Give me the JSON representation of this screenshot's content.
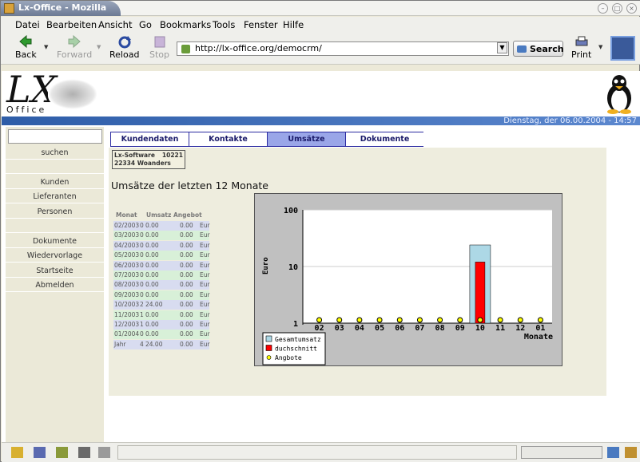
{
  "window": {
    "title": "Lx-Office - Mozilla"
  },
  "menu": [
    {
      "label": "Datei"
    },
    {
      "label": "Bearbeiten"
    },
    {
      "label": "Ansicht"
    },
    {
      "label": "Go"
    },
    {
      "label": "Bookmarks"
    },
    {
      "label": "Tools"
    },
    {
      "label": "Fenster"
    },
    {
      "label": "Hilfe"
    }
  ],
  "toolbar": {
    "back": "Back",
    "forward": "Forward",
    "reload": "Reload",
    "stop": "Stop",
    "url": "http://lx-office.org/democrm/",
    "search": "Search",
    "print": "Print"
  },
  "logo": {
    "lx": "LX",
    "office": "Office"
  },
  "datebar": "Dienstag, der 06.00.2004 - 14:57",
  "sidebar": {
    "items": [
      "suchen",
      "",
      "Kunden",
      "Lieferanten",
      "Personen",
      "",
      "Dokumente",
      "Wiedervorlage",
      "Startseite",
      "Abmelden"
    ]
  },
  "tabs": [
    "Kundendaten",
    "Kontakte",
    "Umsätze",
    "Dokumente"
  ],
  "active_tab": "Umsätze",
  "address": {
    "name": "Lx-Software",
    "number": "10221",
    "city": "22334 Woanders"
  },
  "heading": "Umsätze der letzten 12 Monate",
  "table": {
    "headers": [
      "Monat",
      "Umsatz",
      "Angebot"
    ],
    "rows": [
      [
        "02/2003",
        "0",
        "0.00",
        "0.00",
        "Eur"
      ],
      [
        "03/2003",
        "0",
        "0.00",
        "0.00",
        "Eur"
      ],
      [
        "04/2003",
        "0",
        "0.00",
        "0.00",
        "Eur"
      ],
      [
        "05/2003",
        "0",
        "0.00",
        "0.00",
        "Eur"
      ],
      [
        "06/2003",
        "0",
        "0.00",
        "0.00",
        "Eur"
      ],
      [
        "07/2003",
        "0",
        "0.00",
        "0.00",
        "Eur"
      ],
      [
        "08/2003",
        "0",
        "0.00",
        "0.00",
        "Eur"
      ],
      [
        "09/2003",
        "0",
        "0.00",
        "0.00",
        "Eur"
      ],
      [
        "10/2003",
        "2",
        "24.00",
        "0.00",
        "Eur"
      ],
      [
        "11/2003",
        "1",
        "0.00",
        "0.00",
        "Eur"
      ],
      [
        "12/2003",
        "1",
        "0.00",
        "0.00",
        "Eur"
      ],
      [
        "01/2004",
        "0",
        "0.00",
        "0.00",
        "Eur"
      ],
      [
        "Jahr",
        "4",
        "24.00",
        "0.00",
        "Eur"
      ]
    ]
  },
  "chart_data": {
    "type": "bar",
    "categories": [
      "02",
      "03",
      "04",
      "05",
      "06",
      "07",
      "08",
      "09",
      "10",
      "11",
      "12",
      "01"
    ],
    "series": [
      {
        "name": "Gesamtumsatz",
        "color": "#add8e6",
        "values": [
          1,
          1,
          1,
          1,
          1,
          1,
          1,
          1,
          24,
          1,
          1,
          1
        ]
      },
      {
        "name": "duchschnitt",
        "color": "#ff0000",
        "values": [
          1,
          1,
          1,
          1,
          1,
          1,
          1,
          1,
          12,
          1,
          1,
          1
        ]
      },
      {
        "name": "Angbote",
        "color": "#ffff00",
        "values": [
          1,
          1,
          1,
          1,
          1,
          1,
          1,
          1,
          1,
          1,
          1,
          1
        ]
      }
    ],
    "xlabel": "Monate",
    "ylabel": "Euro",
    "yscale": "log",
    "ylim": [
      1,
      100
    ],
    "yticks": [
      "1",
      "10",
      "100"
    ],
    "grid": true,
    "legend": "bottom-left"
  }
}
